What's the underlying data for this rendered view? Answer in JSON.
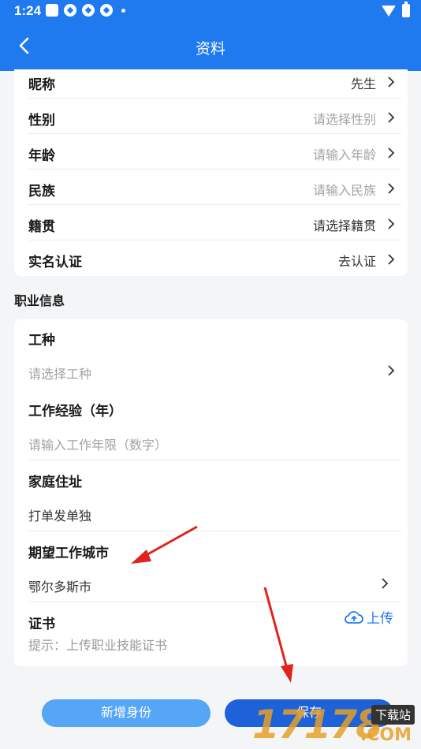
{
  "status_bar": {
    "time": "1:24"
  },
  "nav": {
    "title": "资料"
  },
  "profile": {
    "rows": [
      {
        "label": "昵称",
        "value": "先生"
      },
      {
        "label": "性别",
        "value": "请选择性别"
      },
      {
        "label": "年龄",
        "value": "请输入年龄"
      },
      {
        "label": "民族",
        "value": "请输入民族"
      },
      {
        "label": "籍贯",
        "value": "请选择籍贯"
      },
      {
        "label": "实名认证",
        "value": "去认证"
      }
    ]
  },
  "career": {
    "section_title": "职业信息",
    "work_type": {
      "label": "工种",
      "placeholder": "请选择工种"
    },
    "experience": {
      "label": "工作经验（年）",
      "placeholder": "请输入工作年限（数字）"
    },
    "address": {
      "label": "家庭住址",
      "value": "打单发单独"
    },
    "expected_city": {
      "label": "期望工作城市",
      "value": "鄂尔多斯市"
    },
    "certificate": {
      "label": "证书",
      "upload_label": "上传",
      "hint": "提示：上传职业技能证书"
    }
  },
  "actions": {
    "add_identity": "新增身份",
    "save": "保存"
  },
  "watermark": {
    "number": "17178",
    "tag": "下载站",
    "domain": ".COM"
  },
  "colors": {
    "primary": "#1f7af0",
    "save_button": "#1d62d8",
    "add_button": "#55a6f7",
    "annotation_arrow": "#e0231c"
  }
}
